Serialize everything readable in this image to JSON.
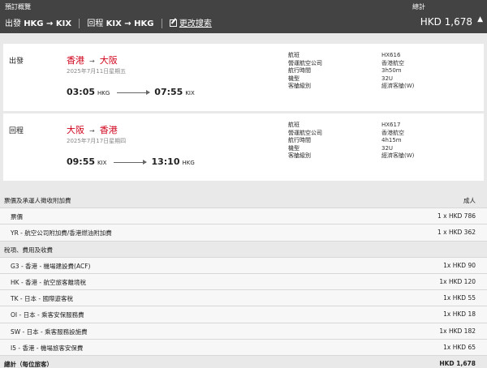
{
  "header": {
    "title": "預訂概覽",
    "outbound_label": "出發",
    "outbound_route": "HKG → KIX",
    "return_label": "回程",
    "return_route": "KIX → HKG",
    "edit_search": "更改搜索",
    "total_label": "總計",
    "total_value": "HKD 1,678",
    "caret": "▲"
  },
  "flights": [
    {
      "label": "出發",
      "from_city": "香港",
      "to_city": "大阪",
      "date": "2025年7月11日星期五",
      "dep_time": "03:05",
      "dep_airport": "HKG",
      "arr_time": "07:55",
      "arr_airport": "KIX",
      "info_labels": [
        "航班",
        "營運航空公司",
        "航行時間",
        "機型",
        "客艙級別"
      ],
      "info_values": [
        "HX616",
        "香港航空",
        "3h50m",
        "32U",
        "經濟客艙(W)"
      ]
    },
    {
      "label": "回程",
      "from_city": "大阪",
      "to_city": "香港",
      "date": "2025年7月17日星期四",
      "dep_time": "09:55",
      "dep_airport": "KIX",
      "arr_time": "13:10",
      "arr_airport": "HKG",
      "info_labels": [
        "航班",
        "營運航空公司",
        "航行時間",
        "機型",
        "客艙級別"
      ],
      "info_values": [
        "HX617",
        "香港航空",
        "4h15m",
        "32U",
        "經濟客艙(W)"
      ]
    }
  ],
  "fares": {
    "section1_title": "票價及承運人徵收附加費",
    "section1_right": "成人",
    "section1_rows": [
      {
        "label": "票價",
        "value": "1 x HKD  786"
      },
      {
        "label": "YR - 航空公司附加費/香港燃油附加費",
        "value": "1 x HKD  362"
      }
    ],
    "section2_title": "稅項、費用及收費",
    "section2_rows": [
      {
        "label": "G3 - 香港 - 機場建設費(ACF)",
        "value": "1x HKD  90"
      },
      {
        "label": "HK - 香港 - 航空旅客離境稅",
        "value": "1x HKD  120"
      },
      {
        "label": "TK - 日本 - 國際遊客稅",
        "value": "1x HKD  55"
      },
      {
        "label": "OI - 日本 - 乘客安保服務費",
        "value": "1x HKD  18"
      },
      {
        "label": "SW - 日本 - 乘客服務設施費",
        "value": "1x HKD  182"
      },
      {
        "label": "I5 - 香港 - 機場旅客安保費",
        "value": "1x HKD  65"
      }
    ],
    "total_label": "總計（每位旅客）",
    "total_value": "HKD  1,678"
  }
}
